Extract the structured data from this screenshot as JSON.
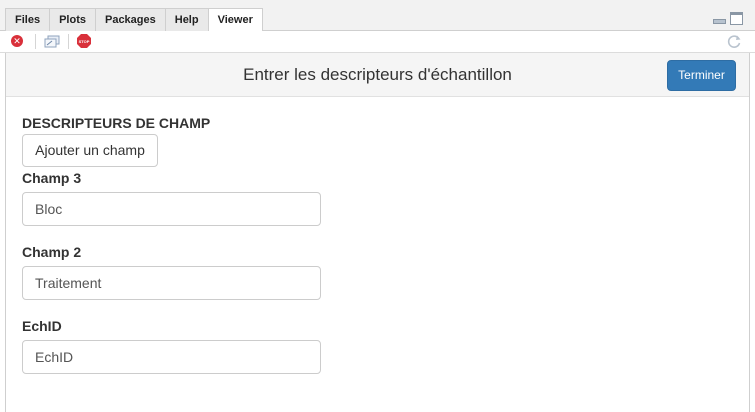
{
  "tabs": [
    {
      "label": "Files"
    },
    {
      "label": "Plots"
    },
    {
      "label": "Packages"
    },
    {
      "label": "Help"
    },
    {
      "label": "Viewer"
    }
  ],
  "active_tab": "Viewer",
  "toolbar": {
    "close_icon": "close-circle-icon",
    "popout_icon": "show-in-window-icon",
    "stop_icon": "stop-icon",
    "stop_label": "STOP",
    "refresh_icon": "refresh-icon"
  },
  "app": {
    "title": "Entrer les descripteurs d'échantillon",
    "done_label": "Terminer",
    "section_title": "DESCRIPTEURS DE CHAMP",
    "add_field_label": "Ajouter un champ",
    "fields": [
      {
        "label": "Champ 3",
        "value": "Bloc"
      },
      {
        "label": "Champ 2",
        "value": "Traitement"
      },
      {
        "label": "EchID",
        "value": "EchID"
      }
    ]
  },
  "colors": {
    "primary_button": "#337ab7",
    "navbar_bg": "#f5f5f5",
    "stop_red": "#d9303a"
  }
}
